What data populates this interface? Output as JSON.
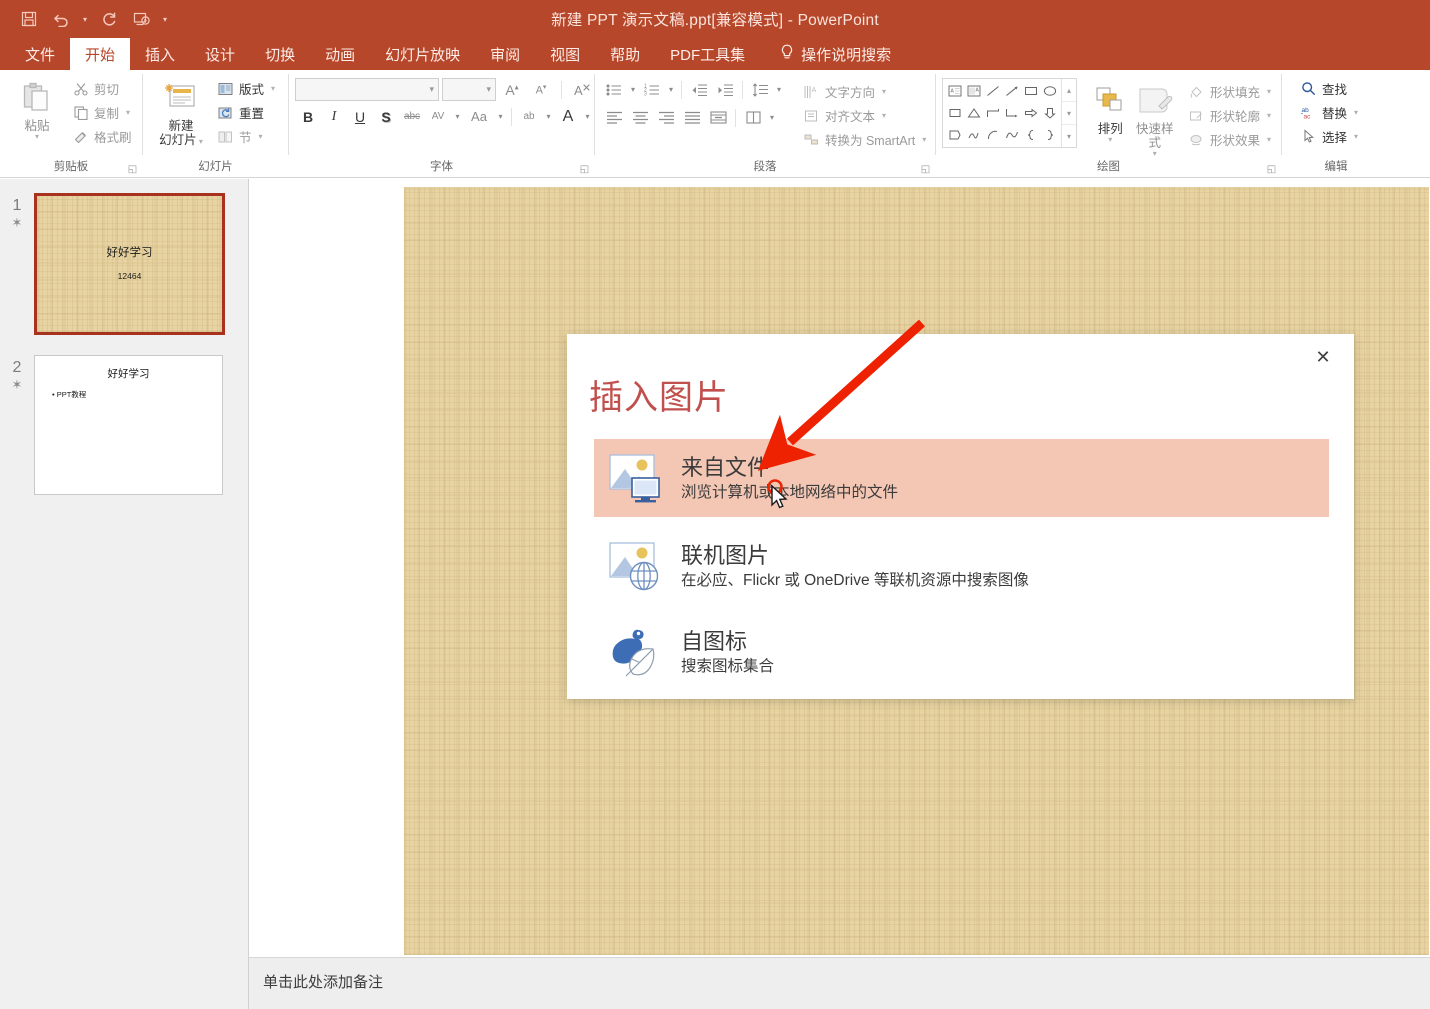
{
  "window": {
    "title": "新建 PPT 演示文稿.ppt[兼容模式]  -  PowerPoint",
    "accent_color": "#b7472a"
  },
  "quick_access": {
    "items": [
      {
        "name": "save-icon",
        "tooltip": "保存"
      },
      {
        "name": "undo-icon",
        "tooltip": "撤消"
      },
      {
        "name": "redo-icon",
        "tooltip": "恢复"
      },
      {
        "name": "start-slideshow-icon",
        "tooltip": "从头开始"
      },
      {
        "name": "customize-qat-icon",
        "tooltip": "自定义快速访问工具栏"
      }
    ]
  },
  "tabs": [
    {
      "label": "文件",
      "active": false
    },
    {
      "label": "开始",
      "active": true
    },
    {
      "label": "插入",
      "active": false
    },
    {
      "label": "设计",
      "active": false
    },
    {
      "label": "切换",
      "active": false
    },
    {
      "label": "动画",
      "active": false
    },
    {
      "label": "幻灯片放映",
      "active": false
    },
    {
      "label": "审阅",
      "active": false
    },
    {
      "label": "视图",
      "active": false
    },
    {
      "label": "帮助",
      "active": false
    },
    {
      "label": "PDF工具集",
      "active": false
    }
  ],
  "tell_me": {
    "label": "操作说明搜索"
  },
  "ribbon": {
    "groups": [
      {
        "label": "剪贴板"
      },
      {
        "label": "幻灯片"
      },
      {
        "label": "字体"
      },
      {
        "label": "段落"
      },
      {
        "label": "绘图"
      },
      {
        "label": "编辑"
      }
    ],
    "clipboard": {
      "paste": "粘贴",
      "cut": "剪切",
      "copy": "复制",
      "format_painter": "格式刷"
    },
    "slides": {
      "new_slide_line1": "新建",
      "new_slide_line2": "幻灯片",
      "layout": "版式",
      "reset": "重置",
      "section": "节"
    },
    "font": {
      "font_name_value": "",
      "font_size_value": "",
      "increase_size": "A",
      "decrease_size": "A",
      "clear_formatting": "A",
      "bold": "B",
      "italic": "I",
      "underline": "U",
      "shadow": "S",
      "strikethrough": "abc",
      "char_spacing": "AV",
      "change_case": "Aa",
      "highlight": "ab",
      "font_color": "A"
    },
    "paragraph": {
      "text_direction": "文字方向",
      "align_text": "对齐文本",
      "convert_smartart": "转换为 SmartArt"
    },
    "drawing": {
      "arrange": "排列",
      "quick_styles_line1": "快速样式",
      "shape_fill": "形状填充",
      "shape_outline": "形状轮廓",
      "shape_effects": "形状效果"
    },
    "editing": {
      "find": "查找",
      "replace": "替换",
      "select": "选择"
    }
  },
  "slides_panel": {
    "slides": [
      {
        "number": "1",
        "selected": true,
        "title": "好好学习",
        "subtitle": "12464"
      },
      {
        "number": "2",
        "selected": false,
        "title": "好好学习",
        "bullet": "PPT教程"
      }
    ]
  },
  "notes": {
    "placeholder": "单击此处添加备注"
  },
  "dialog": {
    "title": "插入图片",
    "close_label": "✕",
    "options": [
      {
        "icon": "picture-from-file-icon",
        "title": "来自文件",
        "description": "浏览计算机或本地网络中的文件",
        "selected": true
      },
      {
        "icon": "online-pictures-icon",
        "title": "联机图片",
        "description": "在必应、Flickr 或 OneDrive 等联机资源中搜索图像",
        "selected": false
      },
      {
        "icon": "icons-library-icon",
        "title": "自图标",
        "description": "搜索图标集合",
        "selected": false
      }
    ]
  },
  "annotation": {
    "arrow_color": "#ee2200",
    "cursor_highlight_color": "#ee2200"
  }
}
